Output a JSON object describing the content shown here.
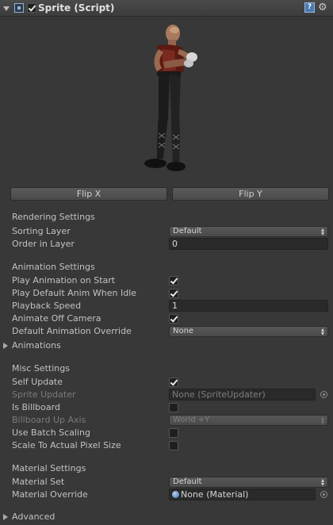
{
  "header": {
    "title": "Sprite (Script)",
    "enabled": true,
    "help_icon": "?",
    "gear_icon": "⚙"
  },
  "buttons": {
    "flip_x": "Flip X",
    "flip_y": "Flip Y"
  },
  "rendering": {
    "section": "Rendering Settings",
    "sorting_layer_label": "Sorting Layer",
    "sorting_layer_value": "Default",
    "order_label": "Order in Layer",
    "order_value": "0"
  },
  "animation": {
    "section": "Animation Settings",
    "play_on_start_label": "Play Animation on Start",
    "play_on_start": true,
    "play_default_idle_label": "Play Default Anim When Idle",
    "play_default_idle": true,
    "playback_speed_label": "Playback Speed",
    "playback_speed_value": "1",
    "animate_off_camera_label": "Animate Off Camera",
    "animate_off_camera": true,
    "default_override_label": "Default Animation Override",
    "default_override_value": "None",
    "animations_foldout": "Animations"
  },
  "misc": {
    "section": "Misc Settings",
    "self_update_label": "Self Update",
    "self_update": true,
    "sprite_updater_label": "Sprite Updater",
    "sprite_updater_value": "None (SpriteUpdater)",
    "is_billboard_label": "Is Billboard",
    "is_billboard": false,
    "billboard_axis_label": "Billboard Up Axis",
    "billboard_axis_value": "World +Y",
    "batch_scaling_label": "Use Batch Scaling",
    "batch_scaling": false,
    "scale_pixel_label": "Scale To Actual Pixel Size",
    "scale_pixel": false
  },
  "material": {
    "section": "Material Settings",
    "material_set_label": "Material Set",
    "material_set_value": "Default",
    "material_override_label": "Material Override",
    "material_override_value": "None (Material)"
  },
  "advanced_foldout": "Advanced",
  "colors": {
    "background": "#383838",
    "text": "#c2c2c2",
    "disabled_text": "#7b7b7b",
    "field_bg": "#2a2a2a"
  }
}
